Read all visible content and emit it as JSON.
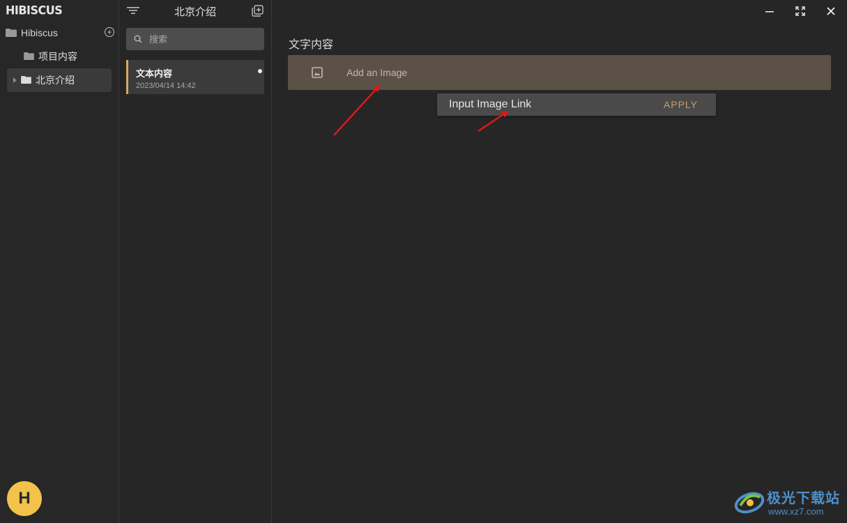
{
  "sidebar": {
    "logo": "HIBISCUS",
    "root_label": "Hibiscus",
    "items": [
      {
        "label": "项目内容"
      },
      {
        "label": "北京介绍"
      }
    ],
    "avatar_letter": "H"
  },
  "notelist": {
    "title": "北京介绍",
    "search_placeholder": "搜索",
    "notes": [
      {
        "title": "文本内容",
        "date": "2023/04/14 14:42"
      }
    ]
  },
  "editor": {
    "title": "文字内容",
    "image_block_label": "Add an Image",
    "popup_placeholder": "Input Image Link",
    "apply_label": "APPLY"
  },
  "watermark": {
    "brand": "极光下载站",
    "url": "www.xz7.com"
  },
  "colors": {
    "accent": "#d6aa63",
    "apply": "#c89f6a",
    "image_block_bg": "#5b5147",
    "avatar_bg": "#f3c24b",
    "annotation_arrow": "#e01818"
  }
}
